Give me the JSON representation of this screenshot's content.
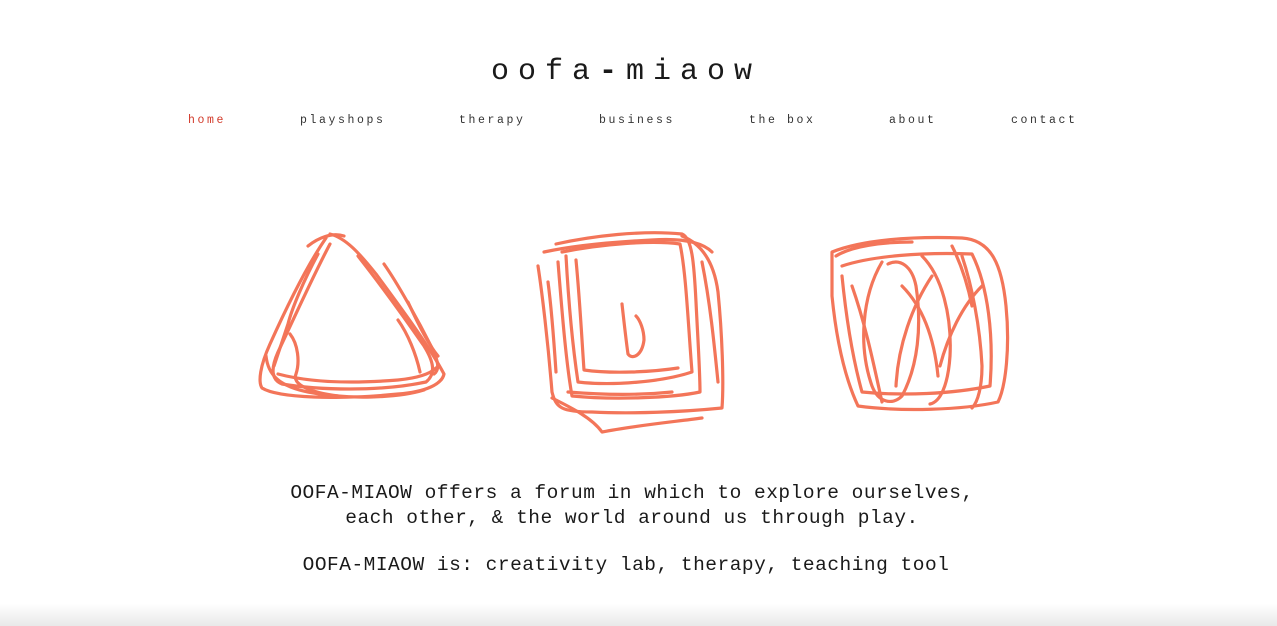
{
  "header": {
    "title_part1": "oofa",
    "title_dash": "-",
    "title_part2": "miaow"
  },
  "nav": {
    "items": [
      {
        "label": "home",
        "active": true
      },
      {
        "label": "playshops",
        "active": false
      },
      {
        "label": "therapy",
        "active": false
      },
      {
        "label": "business",
        "active": false
      },
      {
        "label": "the box",
        "active": false
      },
      {
        "label": "about",
        "active": false
      },
      {
        "label": "contact",
        "active": false
      }
    ]
  },
  "hero": {
    "drawings": [
      "triangle-scribble",
      "square-scribble",
      "circle-scribble"
    ],
    "stroke_color": "#f26a4b"
  },
  "intro": {
    "line1": "OOFA-MIAOW offers a forum in which to explore ourselves,",
    "line2": "each other, & the world around us through play.",
    "line3": "OOFA-MIAOW is: creativity lab, therapy, teaching tool"
  },
  "colors": {
    "active_nav": "#d23a2a",
    "text": "#1a1a1a",
    "crayon": "#f26a4b"
  }
}
